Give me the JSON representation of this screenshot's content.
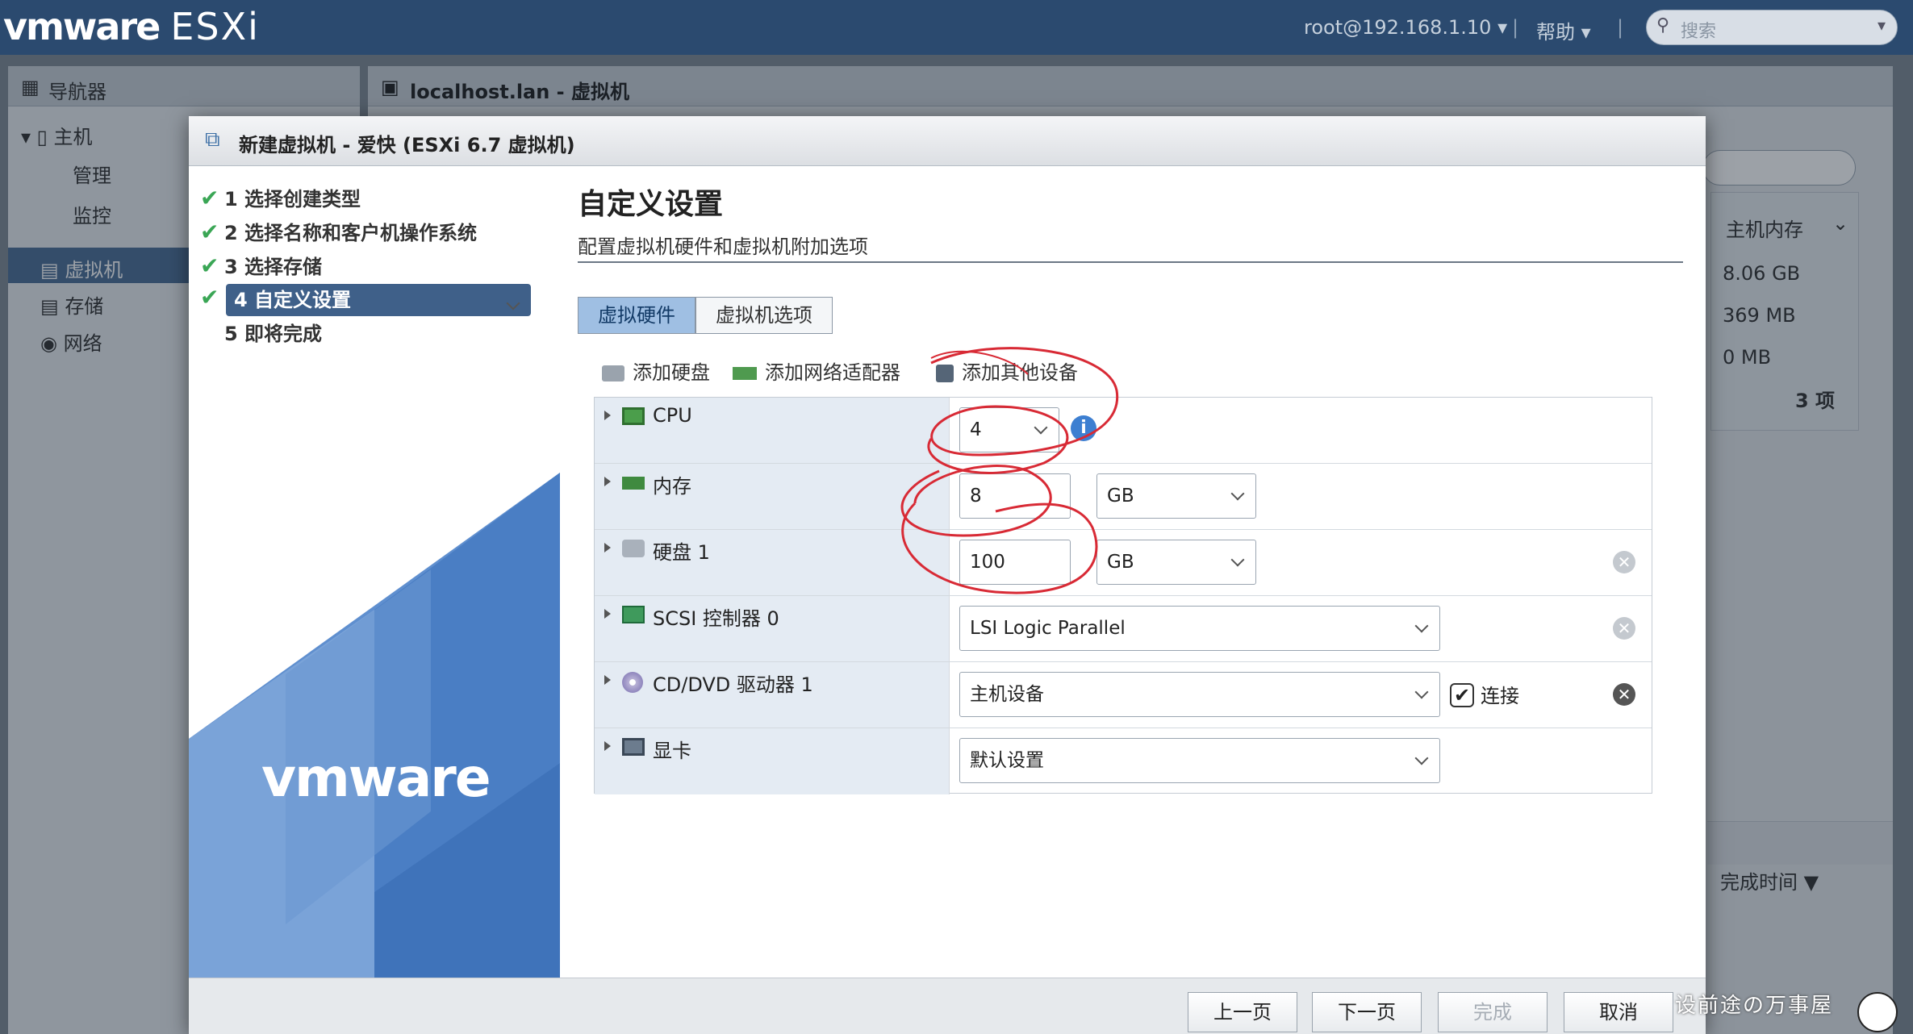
{
  "topbar": {
    "logo": "vmware",
    "product": "ESXi",
    "user": "root@192.168.1.10",
    "help": "帮助",
    "search_placeholder": "搜索"
  },
  "navigator": {
    "title": "导航器",
    "items": [
      "主机",
      "管理",
      "监控",
      "虚拟机",
      "存储",
      "网络"
    ]
  },
  "main": {
    "title": "localhost.lan - 虚拟机",
    "col_memory": "主机内存",
    "memory_values": [
      "8.06 GB",
      "369 MB",
      "0 MB"
    ],
    "count": "3 项",
    "col_finish": "完成时间 ▼"
  },
  "dialog": {
    "title": "新建虚拟机 - 爱快 (ESXi 6.7 虚拟机)",
    "steps": [
      {
        "label": "1 选择创建类型",
        "done": true
      },
      {
        "label": "2 选择名称和客户机操作系统",
        "done": true
      },
      {
        "label": "3 选择存储",
        "done": true
      },
      {
        "label": "4 自定义设置",
        "done": true,
        "selected": true
      },
      {
        "label": "5 即将完成",
        "done": false
      }
    ],
    "brand": "vmware",
    "heading": "自定义设置",
    "subheading": "配置虚拟机硬件和虚拟机附加选项",
    "tabs": [
      "虚拟硬件",
      "虚拟机选项"
    ],
    "actions": [
      "添加硬盘",
      "添加网络适配器",
      "添加其他设备"
    ],
    "hardware": [
      {
        "label": "CPU",
        "value": "4"
      },
      {
        "label": "内存",
        "value": "8",
        "unit": "GB"
      },
      {
        "label": "硬盘 1",
        "value": "100",
        "unit": "GB"
      },
      {
        "label": "SCSI 控制器 0",
        "value": "LSI Logic Parallel"
      },
      {
        "label": "CD/DVD 驱动器 1",
        "value": "主机设备",
        "connect": "连接"
      },
      {
        "label": "显卡",
        "value": "默认设置"
      }
    ],
    "buttons": {
      "back": "上一页",
      "next": "下一页",
      "finish": "完成",
      "cancel": "取消"
    }
  },
  "watermark": "设前途の万事屋"
}
